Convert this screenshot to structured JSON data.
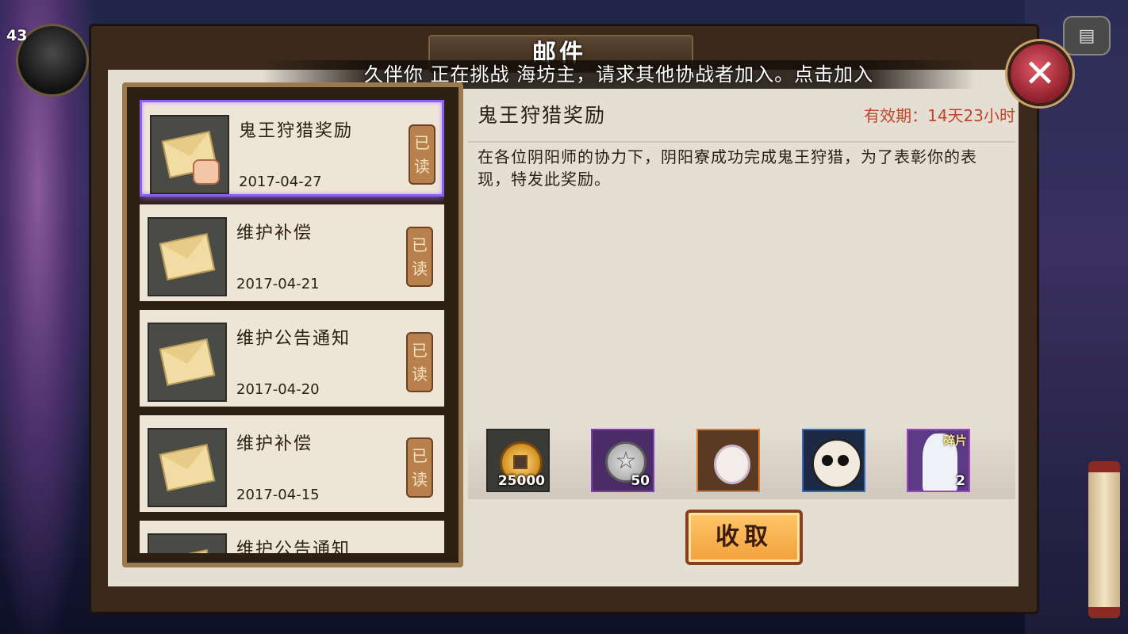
{
  "player": {
    "level": "43"
  },
  "window": {
    "title": "邮件",
    "broadcast": "久伴你 正在挑战 海坊主，请求其他协战者加入。点击加入"
  },
  "icons": {
    "close": "close-icon",
    "chat": "chat-icon"
  },
  "mail_list": [
    {
      "title": "鬼王狩猎奖励",
      "date": "2017-04-27",
      "status": "已读",
      "icon": "gift-envelope-icon",
      "selected": true
    },
    {
      "title": "维护补偿",
      "date": "2017-04-21",
      "status": "已读",
      "icon": "envelope-icon",
      "selected": false
    },
    {
      "title": "维护公告通知",
      "date": "2017-04-20",
      "status": "已读",
      "icon": "envelope-icon",
      "selected": false
    },
    {
      "title": "维护补偿",
      "date": "2017-04-15",
      "status": "已读",
      "icon": "envelope-icon",
      "selected": false
    },
    {
      "title": "维护公告通知",
      "date": "",
      "status": "",
      "icon": "envelope-icon",
      "selected": false
    }
  ],
  "detail": {
    "title": "鬼王狩猎奖励",
    "expiry": "有效期：14天23小时",
    "body": "在各位阴阳师的协力下，阴阳寮成功完成鬼王狩猎，为了表彰你的表现，特发此奖励。",
    "rewards": [
      {
        "icon": "gold-coin-icon",
        "count": "25000",
        "border": "#3a3a3a"
      },
      {
        "icon": "pentagram-icon",
        "count": "50",
        "border": "#7a3fb0"
      },
      {
        "icon": "shikigami-portrait-icon",
        "count": "",
        "border": "#e07b2c"
      },
      {
        "icon": "daruma-icon",
        "count": "",
        "border": "#3a6ac0"
      },
      {
        "icon": "shikigami-fragment-icon",
        "count": "2",
        "label": "碎片",
        "border": "#9a4ab8"
      }
    ],
    "collect_label": "收取"
  }
}
